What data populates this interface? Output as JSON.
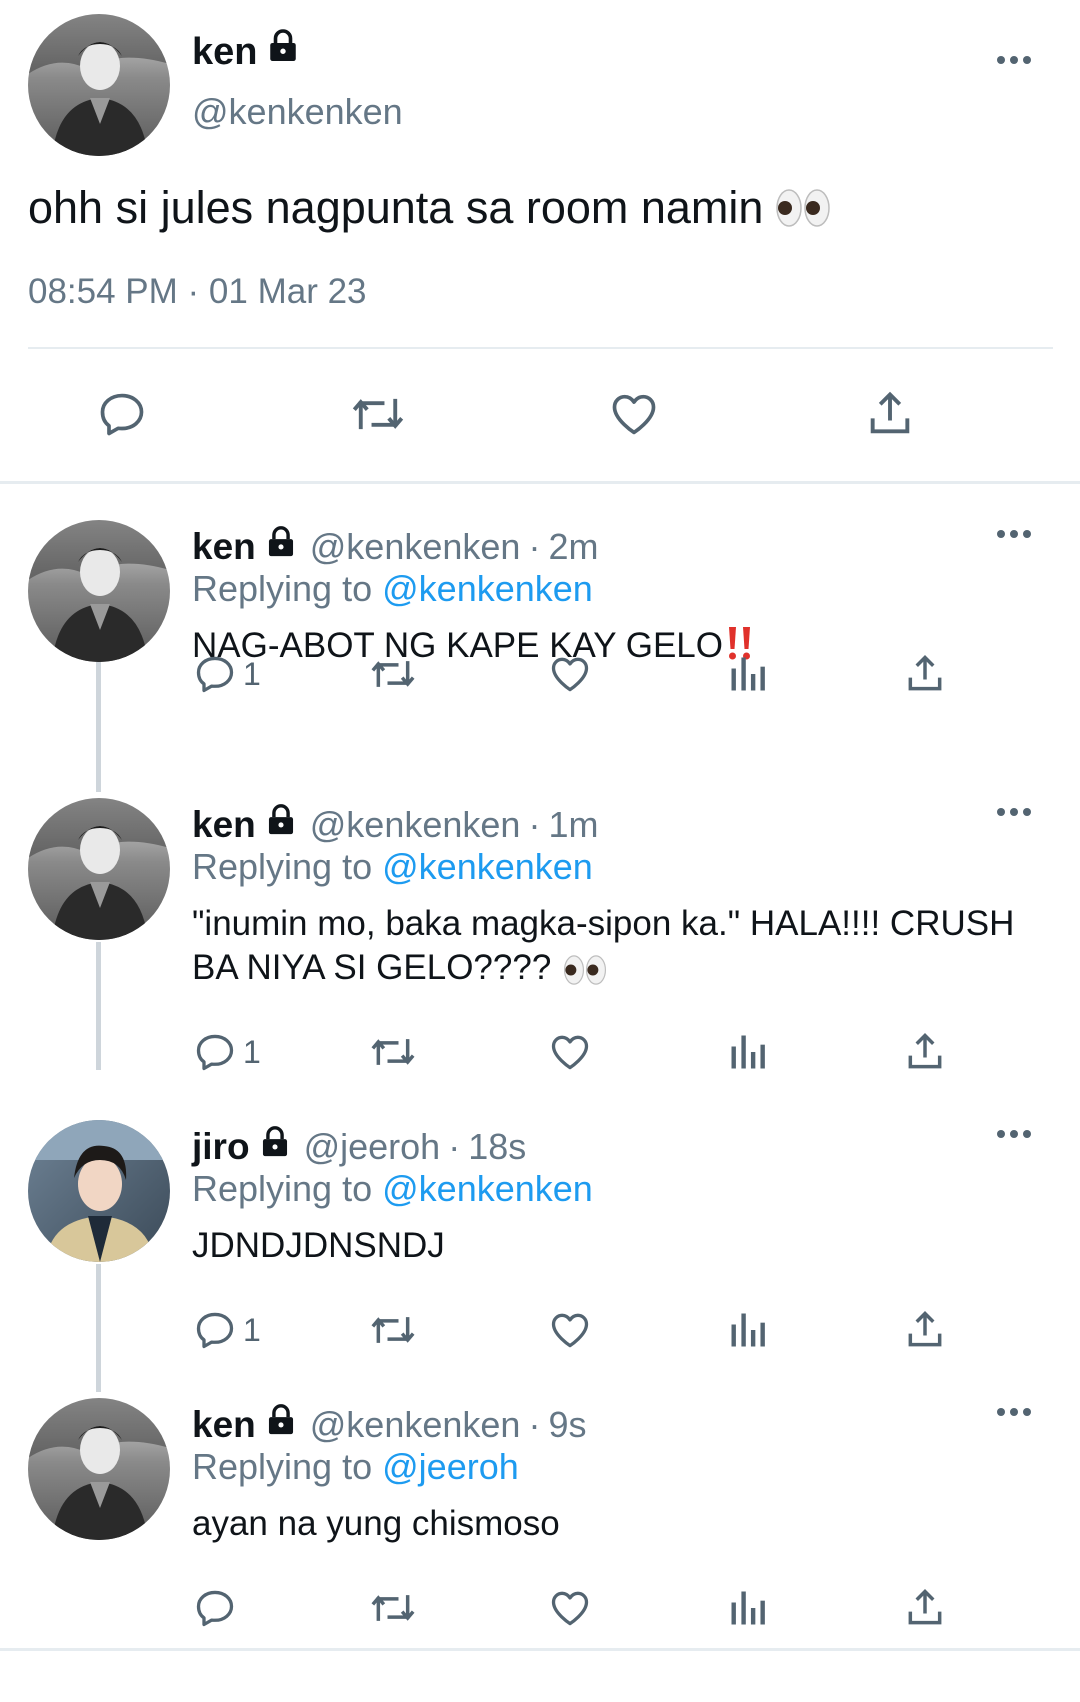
{
  "main_tweet": {
    "name": "ken",
    "handle": "@kenkenken",
    "text": "ohh si jules nagpunta sa room namin",
    "timestamp": "08:54 PM · 01 Mar 23"
  },
  "replies": [
    {
      "name": "ken",
      "handle": "@kenkenken",
      "sep": "·",
      "time": "2m",
      "replying_prefix": "Replying to",
      "replying_to": "@kenkenken",
      "text": "NAG-ABOT NG KAPE KAY GELO",
      "reply_count": "1"
    },
    {
      "name": "ken",
      "handle": "@kenkenken",
      "sep": "·",
      "time": "1m",
      "replying_prefix": "Replying to",
      "replying_to": "@kenkenken",
      "text": "\"inumin mo, baka magka-sipon ka.\" HALA!!!! CRUSH BA NIYA SI GELO????",
      "reply_count": "1"
    },
    {
      "name": "jiro",
      "handle": "@jeeroh",
      "sep": "·",
      "time": "18s",
      "replying_prefix": "Replying to",
      "replying_to": "@kenkenken",
      "text": "JDNDJDNSNDJ",
      "reply_count": "1"
    },
    {
      "name": "ken",
      "handle": "@kenkenken",
      "sep": "·",
      "time": "9s",
      "replying_prefix": "Replying to",
      "replying_to": "@jeeroh",
      "text": "ayan na yung chismoso",
      "reply_count": ""
    }
  ],
  "colors": {
    "text": "#0f1419",
    "secondary": "#657786",
    "link": "#1d9bf0",
    "icon": "#536471",
    "divider": "#e6ecf0",
    "thread_line": "#ced5db"
  },
  "icons": [
    "lock-icon",
    "more-icon",
    "reply-icon",
    "retweet-icon",
    "like-icon",
    "share-icon",
    "views-icon",
    "eyes-emoji",
    "double-exclamation-emoji"
  ]
}
